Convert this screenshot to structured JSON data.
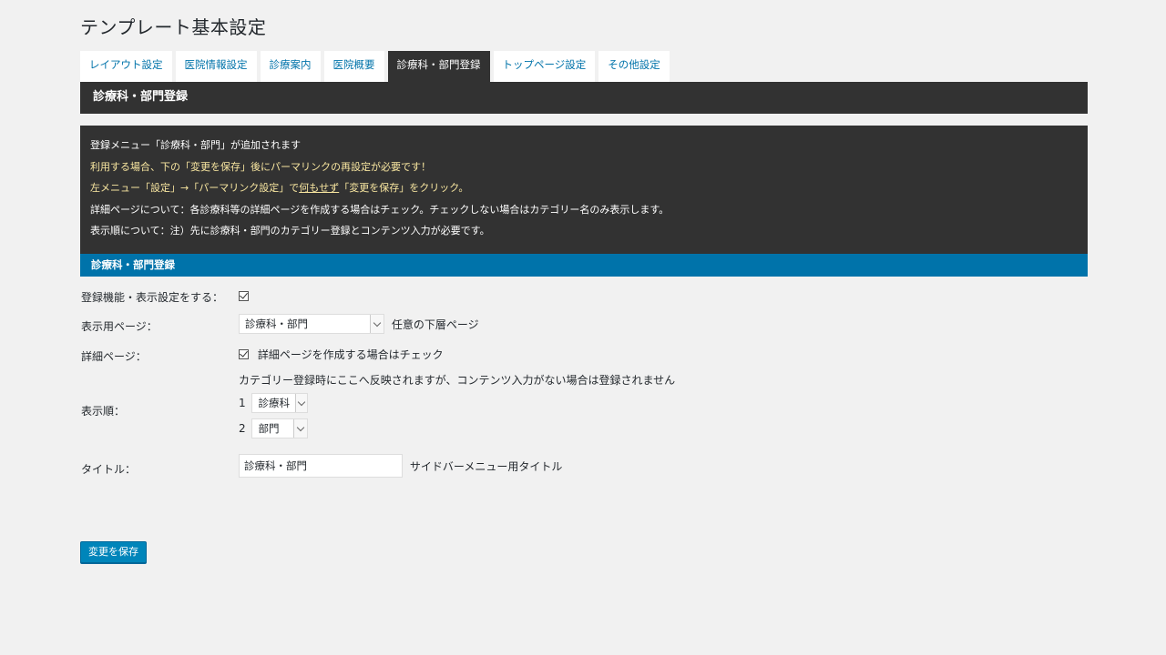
{
  "page": {
    "title": "テンプレート基本設定"
  },
  "tabs": [
    {
      "label": "レイアウト設定"
    },
    {
      "label": "医院情報設定"
    },
    {
      "label": "診療案内"
    },
    {
      "label": "医院概要"
    },
    {
      "label": "診療科・部門登録"
    },
    {
      "label": "トップページ設定"
    },
    {
      "label": "その他設定"
    }
  ],
  "active_tab": "診療科・部門登録",
  "section_title": "診療科・部門登録",
  "notice": {
    "line1": "登録メニュー「診療科・部門」が追加されます",
    "line2": "利用する場合、下の「変更を保存」後にパーマリンクの再設定が必要です！",
    "line3_pre": "左メニュー「設定」→「パーマリンク設定」で",
    "line3_link": "何もせず",
    "line3_post": "「変更を保存」をクリック。",
    "line4": "詳細ページについて：各診療科等の詳細ページを作成する場合はチェック。チェックしない場合はカテゴリー名のみ表示します。",
    "line5": "表示順について：注）先に診療科・部門のカテゴリー登録とコンテンツ入力が必要です。"
  },
  "form_section_title": "診療科・部門登録",
  "form": {
    "enable": {
      "label": "登録機能・表示設定をする：",
      "checked": true
    },
    "display_page": {
      "label": "表示用ページ：",
      "selected": "診療科・部門",
      "note": "任意の下層ページ"
    },
    "detail_page": {
      "label": "詳細ページ：",
      "checked": true,
      "checkbox_label": "詳細ページを作成する場合はチェック"
    },
    "order": {
      "label": "表示順：",
      "note": "カテゴリー登録時にここへ反映されますが、コンテンツ入力がない場合は登録されません",
      "items": [
        {
          "num": "1",
          "selected": "診療科"
        },
        {
          "num": "2",
          "selected": "部門"
        }
      ]
    },
    "title": {
      "label": "タイトル：",
      "value": "診療科・部門",
      "note": "サイドバーメニュー用タイトル"
    }
  },
  "save_label": "変更を保存",
  "colors": {
    "dark": "#323232",
    "accent": "#0073aa",
    "button": "#0085ba",
    "warn_text": "#f8e6a0"
  }
}
